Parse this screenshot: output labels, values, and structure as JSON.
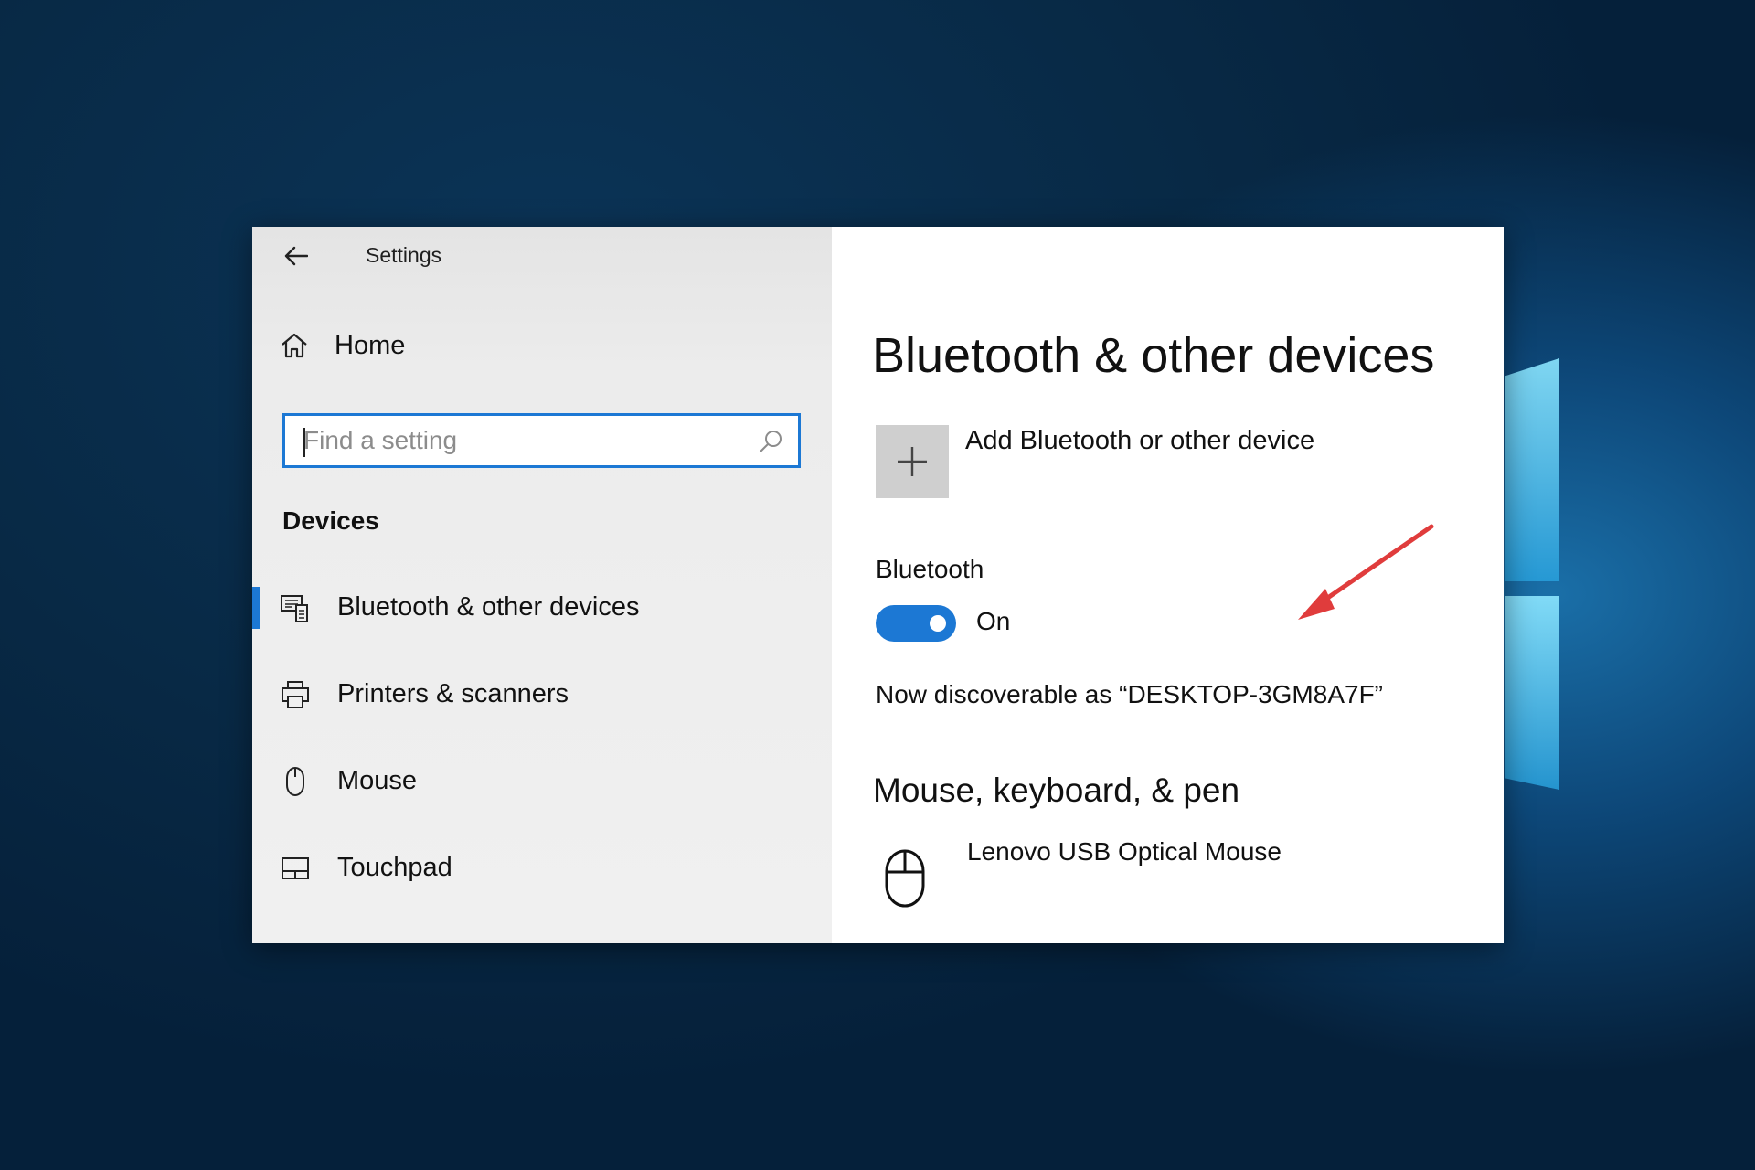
{
  "app": {
    "title": "Settings"
  },
  "sidebar": {
    "home_label": "Home",
    "search": {
      "placeholder": "Find a setting"
    },
    "section_heading": "Devices",
    "items": [
      {
        "label": "Bluetooth & other devices",
        "icon": "bluetooth-devices-icon",
        "selected": true
      },
      {
        "label": "Printers & scanners",
        "icon": "printer-icon",
        "selected": false
      },
      {
        "label": "Mouse",
        "icon": "mouse-icon",
        "selected": false
      },
      {
        "label": "Touchpad",
        "icon": "touchpad-icon",
        "selected": false
      }
    ]
  },
  "main": {
    "page_title": "Bluetooth & other devices",
    "add_device_label": "Add Bluetooth or other device",
    "bluetooth": {
      "label": "Bluetooth",
      "toggle_state": "On",
      "is_on": true
    },
    "discoverable_text": "Now discoverable as “DESKTOP-3GM8A7F”",
    "mouse_section": {
      "title": "Mouse, keyboard, & pen",
      "devices": [
        {
          "name": "Lenovo USB Optical Mouse",
          "icon": "mouse-icon"
        }
      ]
    }
  },
  "colors": {
    "accent": "#1c78d4",
    "annotation_arrow": "#e03c3c",
    "sidebar_bg": "#f0f0f0",
    "add_tile_bg": "#cfcfcf"
  }
}
